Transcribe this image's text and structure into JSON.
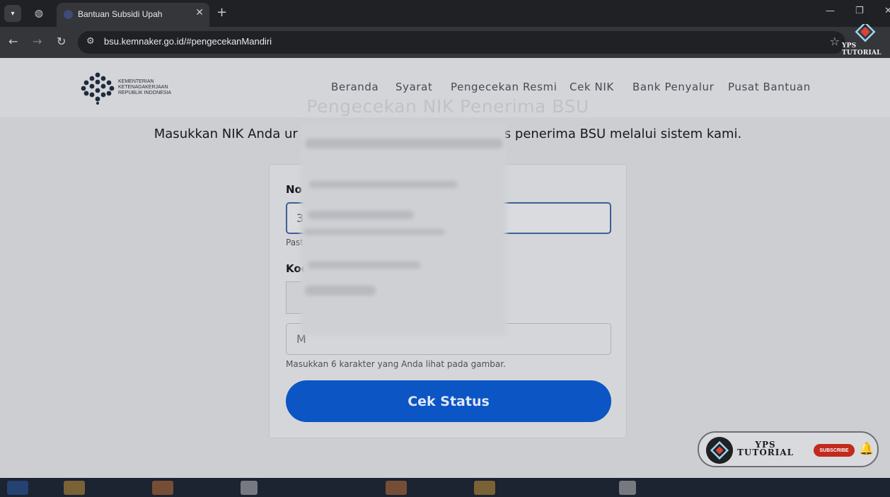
{
  "browser": {
    "tab_title": "Bantuan Subsidi Upah",
    "url": "bsu.kemnaker.go.id/#pengecekanMandiri",
    "watermark_text": "YPS TUTORIAL"
  },
  "header": {
    "logo_lines": [
      "KEMENTERIAN",
      "KETENAGAKERJAAN",
      "REPUBLIK INDONESIA"
    ],
    "menu": [
      "Beranda",
      "Syarat",
      "Pengecekan Resmi",
      "Cek NIK",
      "Bank Penyalur",
      "Pusat Bantuan"
    ]
  },
  "hero": {
    "title": "Pengecekan NIK Penerima BSU",
    "subtitle_left": "Masukkan NIK Anda ur",
    "subtitle_right": "s penerima BSU melalui sistem kami."
  },
  "form": {
    "nik_label": "No",
    "nik_value": "3",
    "nik_hint": "Past",
    "captcha_label": "Koc",
    "captcha_placeholder": "M",
    "captcha_hint": "Masukkan 6 karakter yang Anda lihat pada gambar.",
    "submit_label": "Cek Status"
  },
  "badge": {
    "line1": "YPS",
    "line2": "TUTORIAL",
    "subscribe": "SUBSCRIBE"
  },
  "colors": {
    "primary": "#0b55c4",
    "page_bg": "#cdced1",
    "chrome": "#202124"
  }
}
